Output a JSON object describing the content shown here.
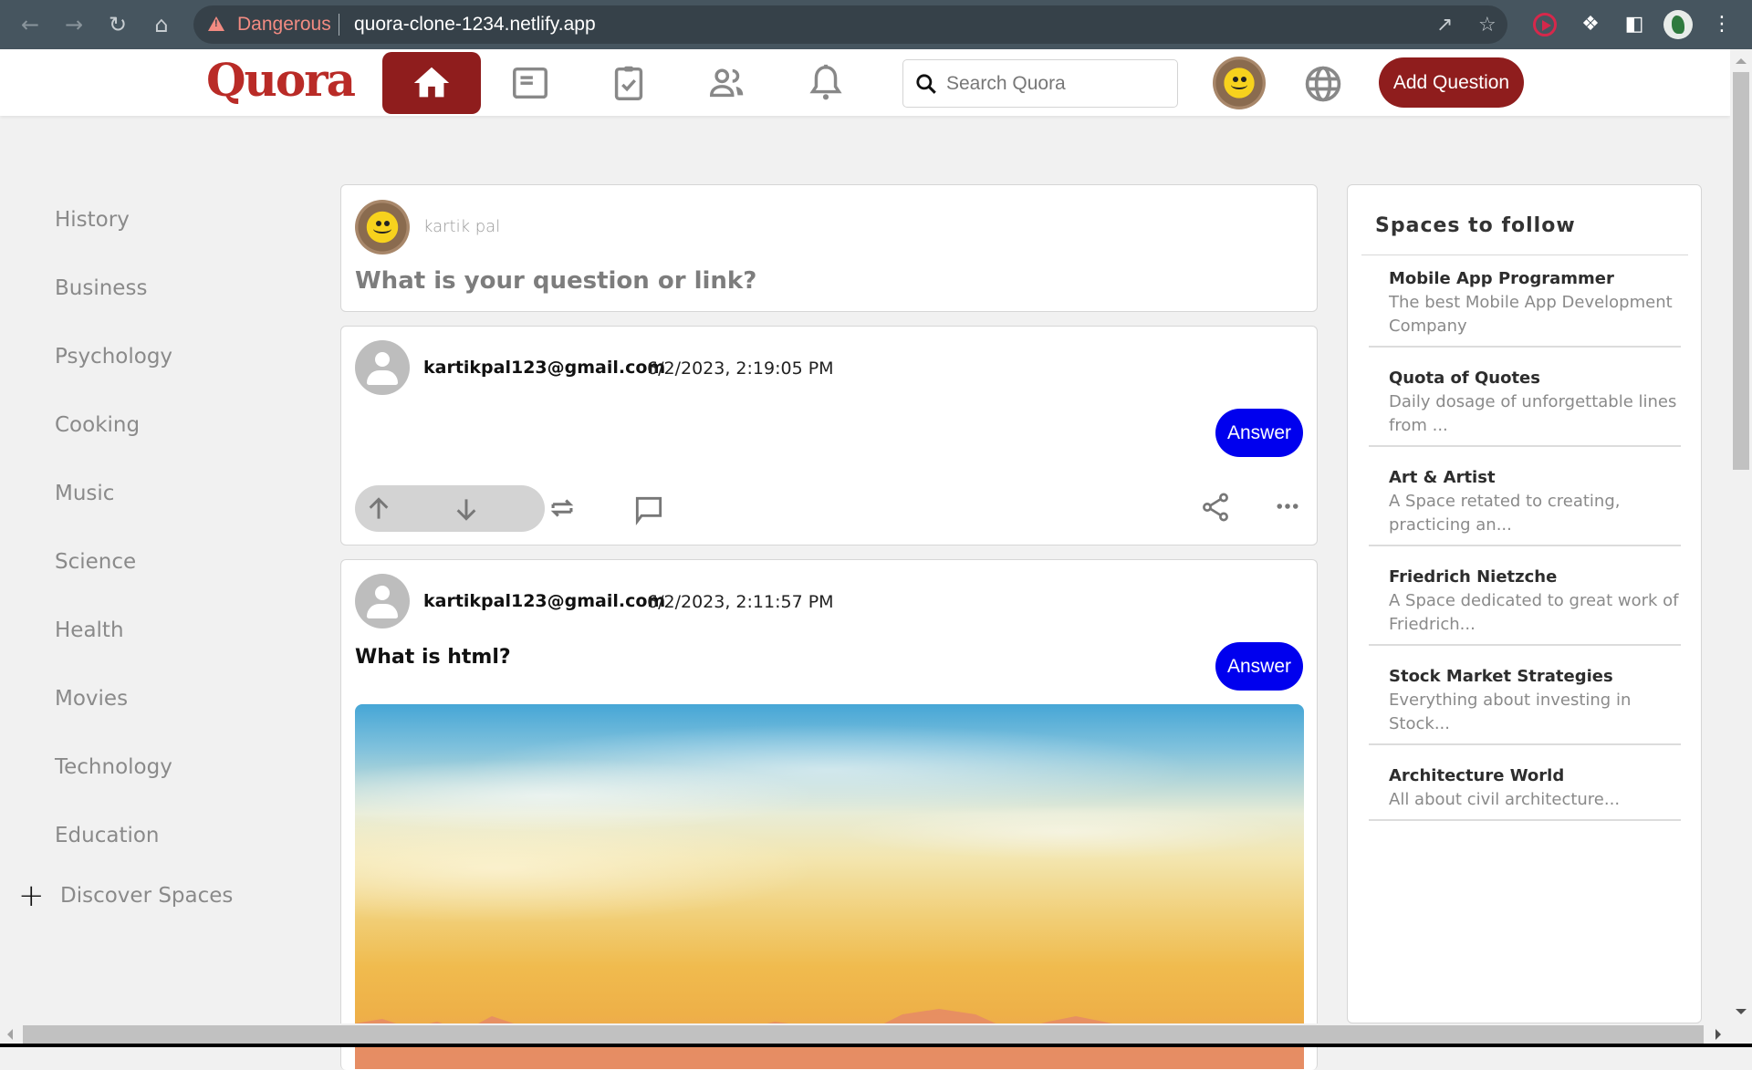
{
  "browser": {
    "security_label": "Dangerous",
    "url": "quora-clone-1234.netlify.app"
  },
  "navbar": {
    "logo": "Quora",
    "search_placeholder": "Search Quora",
    "add_question_label": "Add Question",
    "icons": [
      "home-icon",
      "news-icon",
      "assignment-check-icon",
      "people-icon",
      "notifications-icon"
    ],
    "active_index": 0,
    "brand_color": "#8f1d1d"
  },
  "sidebar": {
    "items": [
      {
        "label": "History"
      },
      {
        "label": "Business"
      },
      {
        "label": "Psychology"
      },
      {
        "label": "Cooking"
      },
      {
        "label": "Music"
      },
      {
        "label": "Science"
      },
      {
        "label": "Health"
      },
      {
        "label": "Movies"
      },
      {
        "label": "Technology"
      },
      {
        "label": "Education"
      }
    ],
    "discover_label": "Discover Spaces"
  },
  "composer": {
    "username": "kartik pal",
    "prompt": "What is your question or link?"
  },
  "posts": [
    {
      "email": "kartikpal123@gmail.com",
      "timestamp": "6/2/2023, 2:19:05 PM",
      "question": "",
      "answer_label": "Answer"
    },
    {
      "email": "kartikpal123@gmail.com",
      "timestamp": "6/2/2023, 2:11:57 PM",
      "question": "What is html?",
      "answer_label": "Answer"
    }
  ],
  "spaces": {
    "title": "Spaces to follow",
    "items": [
      {
        "name": "Mobile App Programmer",
        "desc": "The best Mobile App Development Company"
      },
      {
        "name": "Quota of Quotes",
        "desc": "Daily dosage of unforgettable lines from ..."
      },
      {
        "name": "Art & Artist",
        "desc": "A Space retated to creating, practicing an..."
      },
      {
        "name": "Friedrich Nietzche",
        "desc": "A Space dedicated to great work of Friedrich..."
      },
      {
        "name": "Stock Market Strategies",
        "desc": "Everything about investing in Stock..."
      },
      {
        "name": "Architecture World",
        "desc": "All about civil architecture..."
      }
    ]
  },
  "colors": {
    "answer_button": "#0000ee",
    "logo_red": "#b92b27"
  }
}
